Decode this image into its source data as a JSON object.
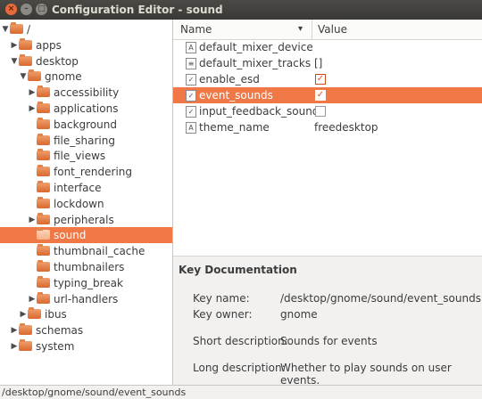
{
  "window": {
    "title": "Configuration Editor - sound",
    "close_label": "×",
    "min_label": "–",
    "max_label": "□"
  },
  "tree": {
    "items": [
      {
        "label": "/",
        "arrow": "▼",
        "depth": 0,
        "selected": false
      },
      {
        "label": "apps",
        "arrow": "▶",
        "depth": 1,
        "selected": false
      },
      {
        "label": "desktop",
        "arrow": "▼",
        "depth": 1,
        "selected": false
      },
      {
        "label": "gnome",
        "arrow": "▼",
        "depth": 2,
        "selected": false
      },
      {
        "label": "accessibility",
        "arrow": "▶",
        "depth": 3,
        "selected": false
      },
      {
        "label": "applications",
        "arrow": "▶",
        "depth": 3,
        "selected": false
      },
      {
        "label": "background",
        "arrow": "",
        "depth": 3,
        "selected": false
      },
      {
        "label": "file_sharing",
        "arrow": "",
        "depth": 3,
        "selected": false
      },
      {
        "label": "file_views",
        "arrow": "",
        "depth": 3,
        "selected": false
      },
      {
        "label": "font_rendering",
        "arrow": "",
        "depth": 3,
        "selected": false
      },
      {
        "label": "interface",
        "arrow": "",
        "depth": 3,
        "selected": false
      },
      {
        "label": "lockdown",
        "arrow": "",
        "depth": 3,
        "selected": false
      },
      {
        "label": "peripherals",
        "arrow": "▶",
        "depth": 3,
        "selected": false
      },
      {
        "label": "sound",
        "arrow": "",
        "depth": 3,
        "selected": true
      },
      {
        "label": "thumbnail_cache",
        "arrow": "",
        "depth": 3,
        "selected": false
      },
      {
        "label": "thumbnailers",
        "arrow": "",
        "depth": 3,
        "selected": false
      },
      {
        "label": "typing_break",
        "arrow": "",
        "depth": 3,
        "selected": false
      },
      {
        "label": "url-handlers",
        "arrow": "▶",
        "depth": 3,
        "selected": false
      },
      {
        "label": "ibus",
        "arrow": "▶",
        "depth": 2,
        "selected": false
      },
      {
        "label": "schemas",
        "arrow": "▶",
        "depth": 1,
        "selected": false
      },
      {
        "label": "system",
        "arrow": "▶",
        "depth": 1,
        "selected": false
      }
    ]
  },
  "keys": {
    "col_name": "Name",
    "col_value": "Value",
    "sort_icon": "▾",
    "rows": [
      {
        "name": "default_mixer_device",
        "type": "string",
        "icon": "A",
        "value": "",
        "selected": false
      },
      {
        "name": "default_mixer_tracks",
        "type": "list",
        "icon": "≡",
        "value": "[]",
        "selected": false
      },
      {
        "name": "enable_esd",
        "type": "bool",
        "icon": "✓",
        "checked": true,
        "selected": false
      },
      {
        "name": "event_sounds",
        "type": "bool",
        "icon": "✓",
        "checked": true,
        "selected": true
      },
      {
        "name": "input_feedback_sounds",
        "type": "bool",
        "icon": "✓",
        "checked": false,
        "selected": false
      },
      {
        "name": "theme_name",
        "type": "string",
        "icon": "A",
        "value": "freedesktop",
        "selected": false
      }
    ]
  },
  "doc": {
    "heading": "Key Documentation",
    "key_name_label": "Key name:",
    "key_name": "/desktop/gnome/sound/event_sounds",
    "key_owner_label": "Key owner:",
    "key_owner": "gnome",
    "short_desc_label": "Short description:",
    "short_desc": "Sounds for events",
    "long_desc_label": "Long description:",
    "long_desc": "Whether to play sounds on user events."
  },
  "status": {
    "path": "/desktop/gnome/sound/event_sounds"
  },
  "colors": {
    "accent": "#f07746",
    "titlebar": "#3c3b37",
    "close": "#e86a3b"
  }
}
